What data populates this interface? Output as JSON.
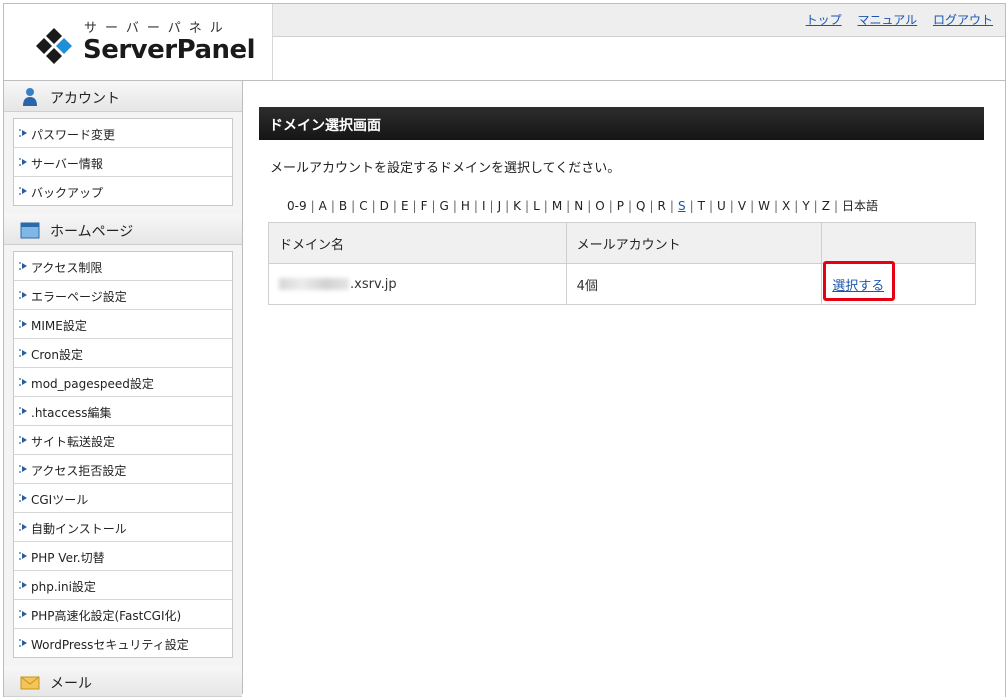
{
  "header": {
    "logo_kana": "サーバーパネル",
    "logo_text": "ServerPanel",
    "links": [
      "トップ",
      "マニュアル",
      "ログアウト"
    ]
  },
  "sidebar": {
    "sections": [
      {
        "title": "アカウント",
        "icon": "user-icon",
        "items": [
          "パスワード変更",
          "サーバー情報",
          "バックアップ"
        ]
      },
      {
        "title": "ホームページ",
        "icon": "window-icon",
        "items": [
          "アクセス制限",
          "エラーページ設定",
          "MIME設定",
          "Cron設定",
          "mod_pagespeed設定",
          ".htaccess編集",
          "サイト転送設定",
          "アクセス拒否設定",
          "CGIツール",
          "自動インストール",
          "PHP Ver.切替",
          "php.ini設定",
          "PHP高速化設定(FastCGI化)",
          "WordPressセキュリティ設定"
        ]
      },
      {
        "title": "メール",
        "icon": "mail-icon",
        "items": []
      }
    ]
  },
  "main": {
    "title": "ドメイン選択画面",
    "description": "メールアカウントを設定するドメインを選択してください。",
    "alpha_index": [
      "0-9",
      "A",
      "B",
      "C",
      "D",
      "E",
      "F",
      "G",
      "H",
      "I",
      "J",
      "K",
      "L",
      "M",
      "N",
      "O",
      "P",
      "Q",
      "R",
      "S",
      "T",
      "U",
      "V",
      "W",
      "X",
      "Y",
      "Z",
      "日本語"
    ],
    "alpha_active": "S",
    "table": {
      "headers": [
        "ドメイン名",
        "メールアカウント",
        ""
      ],
      "rows": [
        {
          "domain_suffix": ".xsrv.jp",
          "accounts": "4個",
          "action": "選択する"
        }
      ]
    }
  },
  "colors": {
    "link": "#1a55b0",
    "highlight": "#e60012",
    "title_bar": "#1e1e1e"
  }
}
